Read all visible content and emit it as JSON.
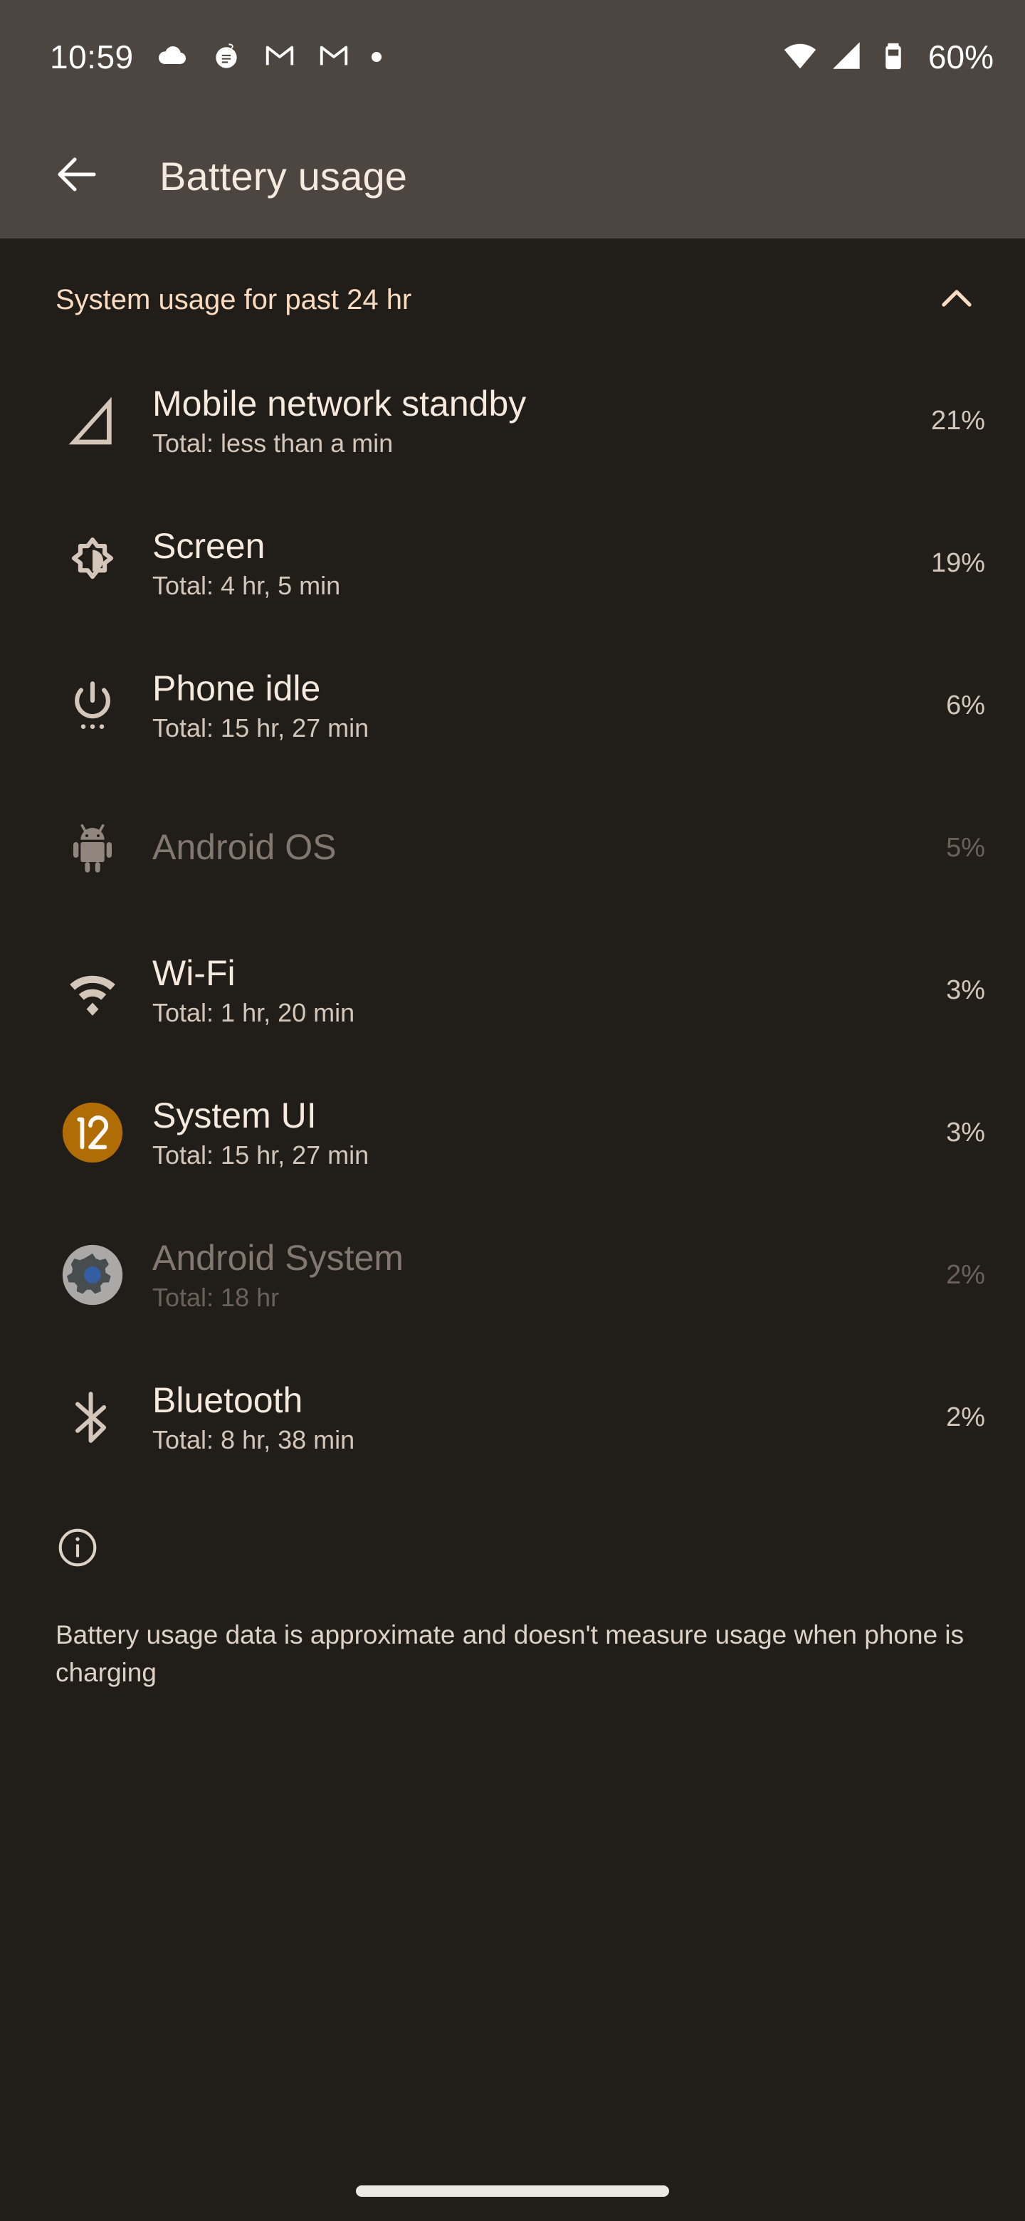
{
  "status_bar": {
    "time": "10:59",
    "battery_percent": "60%",
    "left_icons": [
      "cloud-icon",
      "nyt-icon",
      "gmail-icon",
      "gmail-icon",
      "notification-dot-icon"
    ],
    "right_icons": [
      "wifi-icon",
      "cellular-signal-icon",
      "battery-icon"
    ]
  },
  "app_bar": {
    "back_icon": "back-arrow-icon",
    "title": "Battery usage"
  },
  "section": {
    "title": "System usage for past 24 hr",
    "collapse_icon": "chevron-up-icon",
    "expanded": true
  },
  "items": [
    {
      "name": "Mobile network standby",
      "subtitle": "Total: less than a min",
      "percent": "21%",
      "icon": "cellular-signal-icon",
      "dimmed": false
    },
    {
      "name": "Screen",
      "subtitle": "Total: 4 hr, 5 min",
      "percent": "19%",
      "icon": "brightness-icon",
      "dimmed": false
    },
    {
      "name": "Phone idle",
      "subtitle": "Total: 15 hr, 27 min",
      "percent": "6%",
      "icon": "power-idle-icon",
      "dimmed": false
    },
    {
      "name": "Android OS",
      "subtitle": "",
      "percent": "5%",
      "icon": "android-robot-icon",
      "dimmed": true
    },
    {
      "name": "Wi-Fi",
      "subtitle": "Total: 1 hr, 20 min",
      "percent": "3%",
      "icon": "wifi-icon",
      "dimmed": false
    },
    {
      "name": "System UI",
      "subtitle": "Total: 15 hr, 27 min",
      "percent": "3%",
      "icon": "system-ui-android12-icon",
      "dimmed": false
    },
    {
      "name": "Android System",
      "subtitle": "Total: 18 hr",
      "percent": "2%",
      "icon": "settings-gear-icon",
      "dimmed": true
    },
    {
      "name": "Bluetooth",
      "subtitle": "Total: 8 hr, 38 min",
      "percent": "2%",
      "icon": "bluetooth-icon",
      "dimmed": false
    }
  ],
  "footer": {
    "info_icon": "info-icon",
    "text": "Battery usage data is approximate and doesn't measure usage when phone is charging"
  },
  "nav_bar": {
    "handle_icon": "gesture-handle-icon"
  },
  "colors": {
    "app_bar_background": "#4d453f",
    "page_background": "#211e1a",
    "accent": "#fcdcc0",
    "primary_text": "#f6e9de",
    "secondary_text": "#d4c7ba",
    "disabled_text": "#83786f",
    "system_ui_badge": "#b06d06"
  }
}
